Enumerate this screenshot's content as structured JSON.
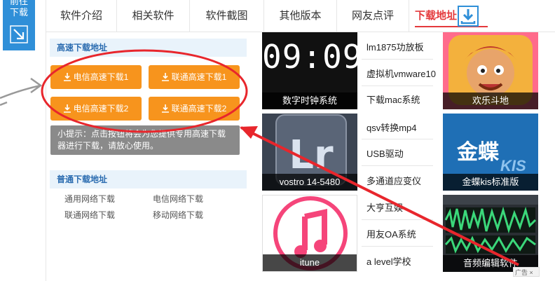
{
  "side_tab": {
    "line1": "前往",
    "line2": "下载"
  },
  "tabs": [
    {
      "label": "软件介绍"
    },
    {
      "label": "相关软件"
    },
    {
      "label": "软件截图"
    },
    {
      "label": "其他版本"
    },
    {
      "label": "网友点评"
    },
    {
      "label": "下载地址"
    }
  ],
  "fast_download": {
    "title": "高速下载地址",
    "buttons": [
      "电信高速下载1",
      "联通高速下载1",
      "电信高速下载2",
      "联通高速下载2"
    ],
    "tip": "小提示：点击按钮将会为您提供专用高速下载器进行下载，请放心使用。"
  },
  "normal_download": {
    "title": "普通下载地址",
    "links": [
      "通用网络下载",
      "电信网络下载",
      "联通网络下载",
      "移动网络下载"
    ]
  },
  "thumbs": [
    {
      "caption": "数字时钟系统",
      "display": "09:09"
    },
    {
      "caption": "欢乐斗地"
    },
    {
      "caption": "vostro 14-5480",
      "display": "Lr"
    },
    {
      "caption": "金蝶kis标准版",
      "brand": "金蝶",
      "brand_sub": "KIS"
    },
    {
      "caption": "itune"
    },
    {
      "caption": "音频编辑软件"
    }
  ],
  "mid_links": [
    "lm1875功放板",
    "虚拟机vmware10",
    "下载mac系统",
    "qsv转换mp4",
    "USB驱动",
    "多通道应变仪",
    "大亨互娱",
    "用友OA系统",
    "a level学校"
  ],
  "ad": {
    "label": "广告",
    "close": "×"
  },
  "colors": {
    "accent_blue": "#2f8fd8",
    "orange": "#f7941d",
    "annotation_red": "#e8262c"
  }
}
